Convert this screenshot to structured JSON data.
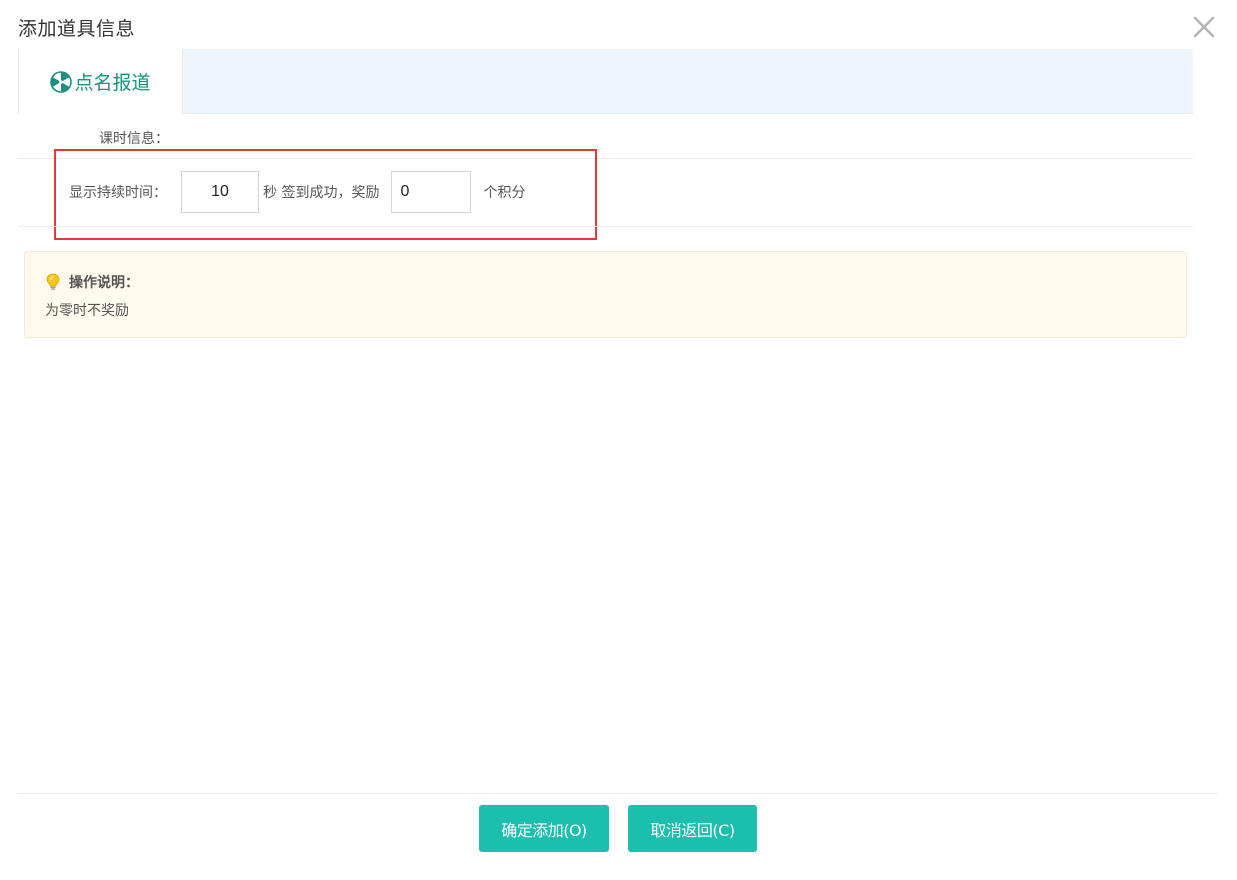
{
  "dialog": {
    "title": "添加道具信息"
  },
  "tabs": [
    {
      "label": "点名报道",
      "icon": "pinwheel-icon",
      "active": true
    }
  ],
  "section": {
    "label": "课时信息："
  },
  "form": {
    "duration_label": "显示持续时间：",
    "duration_value": "10",
    "duration_unit": "秒 签到成功，奖励",
    "reward_value": "0",
    "reward_unit": "个积分"
  },
  "note": {
    "title": "操作说明：",
    "text": "为零时不奖励",
    "icon": "lightbulb-icon"
  },
  "footer": {
    "confirm_label": "确定添加(O)",
    "cancel_label": "取消返回(C)"
  },
  "colors": {
    "accent": "#1bbfae",
    "tab_text": "#14937f",
    "highlight": "#e53935",
    "note_bg": "#fffaed",
    "tab_bar_bg": "#eef6fd"
  }
}
